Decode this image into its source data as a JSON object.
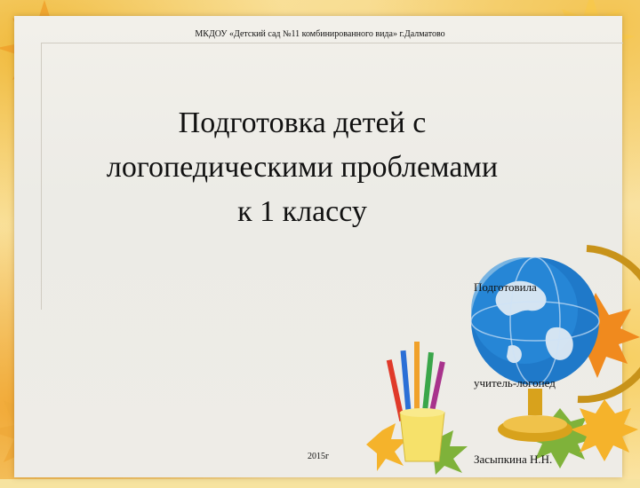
{
  "slide": {
    "organization": "МКДОУ «Детский сад №11 комбинированного вида» г.Далматово",
    "title_line1": "Подготовка детей с",
    "title_line2": "логопедическими проблемами",
    "title_line3": "к 1 классу",
    "prepared_label": "Подготовила",
    "position": "учитель-логопед",
    "author": "Засыпкина Н.Н.",
    "year": "2015г"
  },
  "decor": {
    "icons": [
      "maple-leaf-icon",
      "globe-icon",
      "pencil-cup-icon"
    ],
    "colors": {
      "leaf_orange": "#f0a12a",
      "leaf_yellow": "#f7d24a",
      "leaf_green": "#7fb23a",
      "globe_blue": "#1f79c9",
      "globe_gold": "#d8a21c"
    }
  }
}
